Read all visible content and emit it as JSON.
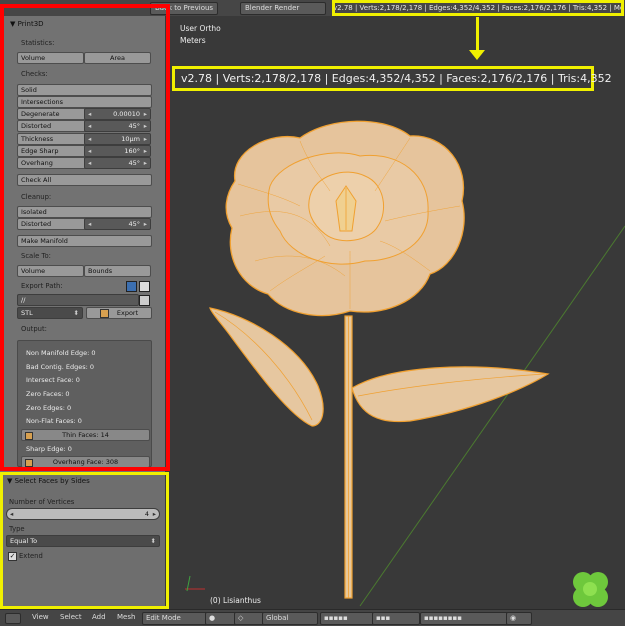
{
  "topbar": {
    "back_label": "Back to Previous",
    "engine": "Blender Render",
    "stats": "v2.78 | Verts:2,178/2,178 | Edges:4,352/4,352 | Faces:2,176/2,176 | Tris:4,352 | Mem:78"
  },
  "viewport": {
    "view_name": "User Ortho",
    "units": "Meters",
    "object_label": "(0) Lisianthus",
    "callout_stats": "v2.78 | Verts:2,178/2,178 | Edges:4,352/4,352 | Faces:2,176/2,176 | Tris:4,352"
  },
  "print3d": {
    "header": "Print3D",
    "statistics_label": "Statistics:",
    "volume_label": "Volume",
    "area_label": "Area",
    "checks_label": "Checks:",
    "solid_label": "Solid",
    "intersections_label": "Intersections",
    "degenerate": {
      "label": "Degenerate",
      "value": "0.00010"
    },
    "distorted": {
      "label": "Distorted",
      "value": "45°"
    },
    "thickness": {
      "label": "Thickness",
      "value": "10µm"
    },
    "edge_sharp": {
      "label": "Edge Sharp",
      "value": "160°"
    },
    "overhang": {
      "label": "Overhang",
      "value": "45°"
    },
    "check_all_label": "Check All",
    "cleanup_label": "Cleanup:",
    "isolated_label": "Isolated",
    "cleanup_distorted": {
      "label": "Distorted",
      "value": "45°"
    },
    "make_manifold_label": "Make Manifold",
    "scale_to_label": "Scale To:",
    "scale_volume_label": "Volume",
    "scale_bounds_label": "Bounds",
    "export_path_label": "Export Path:",
    "export_path_value": "//",
    "format_value": "STL",
    "export_label": "Export",
    "output_label": "Output:",
    "output": {
      "non_manifold": "Non Manifold Edge: 0",
      "bad_contig": "Bad Contig. Edges: 0",
      "intersect": "Intersect Face: 0",
      "zero_faces": "Zero Faces: 0",
      "zero_edges": "Zero Edges: 0",
      "non_flat": "Non-Flat Faces: 0",
      "thin_faces": "Thin Faces: 14",
      "sharp_edge": "Sharp Edge: 0",
      "overhang_face": "Overhang Face: 308"
    }
  },
  "select_faces": {
    "header": "Select Faces by Sides",
    "num_vertices_label": "Number of Vertices",
    "num_vertices_value": "4",
    "type_label": "Type",
    "type_value": "Equal To",
    "extend_label": "Extend"
  },
  "bottombar": {
    "view": "View",
    "select": "Select",
    "add": "Add",
    "mesh": "Mesh",
    "mode": "Edit Mode",
    "orientation": "Global"
  },
  "colors": {
    "highlight_yellow": "#f0f000",
    "highlight_red": "#ff0000",
    "mesh_orange": "#f0a030"
  }
}
